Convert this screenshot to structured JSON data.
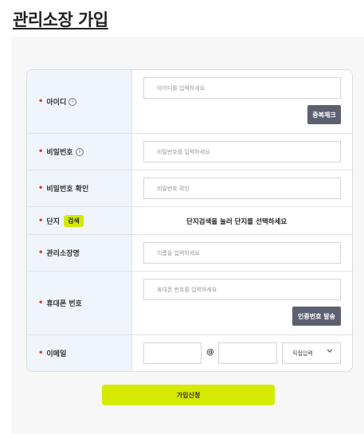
{
  "page": {
    "title": "관리소장 가입"
  },
  "form": {
    "id": {
      "label": "아이디",
      "placeholder": "아이디를 입력하세요",
      "button": "중복체크"
    },
    "password": {
      "label": "비밀번호",
      "placeholder": "비밀번호를 입력하세요"
    },
    "password_confirm": {
      "label": "비밀번호 확인",
      "placeholder": "비밀번호 확인"
    },
    "complex": {
      "label": "단지",
      "badge": "검색",
      "notice": "단지검색을 눌러 단지를 선택하세요"
    },
    "manager_name": {
      "label": "관리소장명",
      "placeholder": "이름을 입력하세요"
    },
    "phone": {
      "label": "휴대폰 번호",
      "placeholder": "휴대폰 번호를 입력하세요",
      "button": "인증번호 발송"
    },
    "email": {
      "label": "이메일",
      "at": "@",
      "domain_select": "직접입력"
    }
  },
  "submit_label": "가입신청",
  "colors": {
    "accent": "#d4ea00",
    "required": "#e23a1d",
    "dark_button": "#5c6070"
  }
}
